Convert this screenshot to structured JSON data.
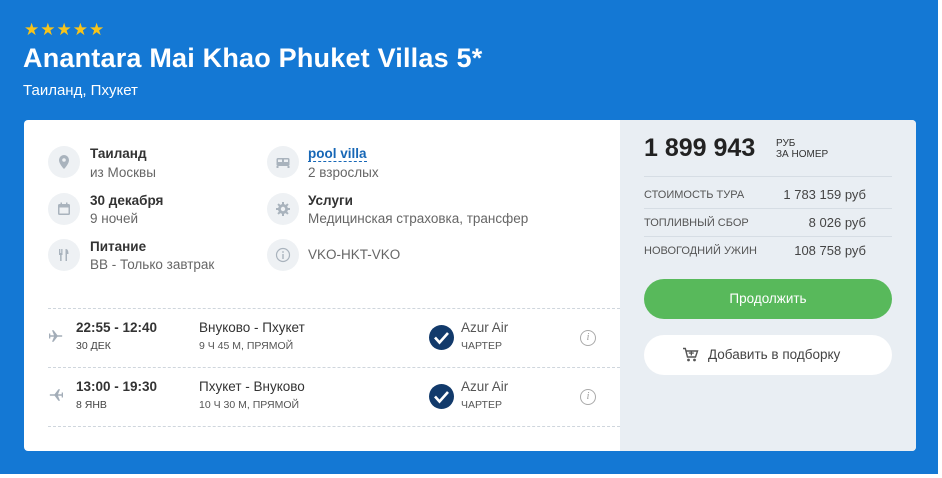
{
  "hotel": {
    "stars": 5,
    "name": "Anantara Mai Khao Phuket Villas 5*",
    "location": "Таиланд, Пхукет"
  },
  "details": {
    "destination": {
      "title": "Таиланд",
      "sub": "из Москвы"
    },
    "dates": {
      "title": "30 декабря",
      "sub": "9 ночей"
    },
    "meals": {
      "title": "Питание",
      "sub": "BB - Только завтрак"
    },
    "room": {
      "title": "pool villa",
      "sub": "2 взрослых"
    },
    "services": {
      "title": "Услуги",
      "sub": "Медицинская страховка, трансфер"
    },
    "route": {
      "title": "VKO-HKT-VKO"
    }
  },
  "flights": [
    {
      "time": "22:55 - 12:40",
      "date": "30 ДЕК",
      "route": "Внуково - Пхукет",
      "duration": "9 Ч 45 М, ПРЯМОЙ",
      "airline": "Azur Air",
      "type": "ЧАРТЕР"
    },
    {
      "time": "13:00 - 19:30",
      "date": "8 ЯНВ",
      "route": "Пхукет - Внуково",
      "duration": "10 Ч 30 М, ПРЯМОЙ",
      "airline": "Azur Air",
      "type": "ЧАРТЕР"
    }
  ],
  "pricing": {
    "total": "1 899 943",
    "currency": "РУБ",
    "per": "ЗА НОМЕР",
    "rows": [
      {
        "label": "Стоимость тура",
        "value": "1 783 159 руб"
      },
      {
        "label": "Топливный сбор",
        "value": "8 026 руб"
      },
      {
        "label": "Новогодний ужин",
        "value": "108 758 руб"
      }
    ],
    "continue_label": "Продолжить",
    "add_label": "Добавить в подборку"
  },
  "colors": {
    "accent": "#1478d4",
    "star": "#f8c41a",
    "button": "#58b95b",
    "link": "#1767b6"
  }
}
